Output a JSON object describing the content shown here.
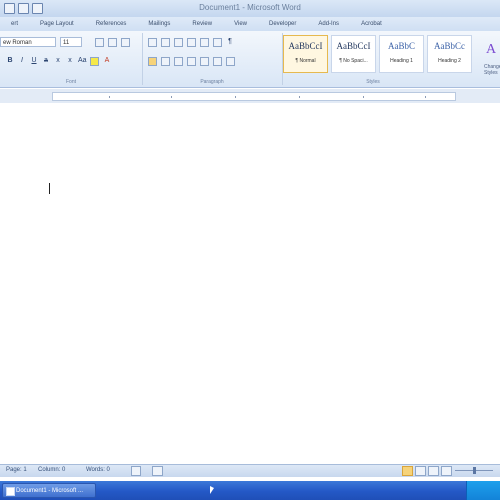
{
  "window": {
    "title": "Document1 - Microsoft Word"
  },
  "tabs": [
    "ert",
    "Page Layout",
    "References",
    "Mailings",
    "Review",
    "View",
    "Developer",
    "Add-Ins",
    "Acrobat"
  ],
  "ribbon": {
    "font_name": "ew Roman",
    "font_size": "11",
    "groups": [
      "Font",
      "Paragraph",
      "Styles"
    ],
    "styles": [
      {
        "sample": "AaBbCcI",
        "name": "¶ Normal",
        "selected": true
      },
      {
        "sample": "AaBbCcI",
        "name": "¶ No Spaci...",
        "selected": false
      },
      {
        "sample": "AaBbC",
        "name": "Heading 1",
        "selected": false
      },
      {
        "sample": "AaBbCc",
        "name": "Heading 2",
        "selected": false
      }
    ],
    "change_styles": "Change Styles"
  },
  "status": {
    "page": "Page: 1",
    "section": "Column: 0",
    "words": "Words: 0"
  },
  "taskbar": {
    "button": "Document1 - Microsoft ..."
  },
  "icons": [
    "save-icon",
    "undo-icon",
    "redo-icon",
    "bold-icon",
    "italic-icon",
    "underline-icon",
    "highlight-icon",
    "font-color-icon",
    "bullets-icon",
    "numbering-icon",
    "align-left-icon",
    "center-icon",
    "pilcrow-icon",
    "cursor-icon"
  ]
}
